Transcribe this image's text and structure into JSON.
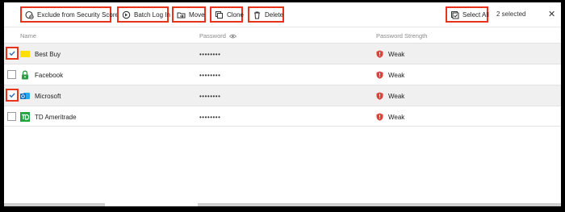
{
  "toolbar": {
    "exclude_label": "Exclude from Security Score",
    "batch_login_label": "Batch Log In",
    "move_label": "Move",
    "clone_label": "Clone",
    "delete_label": "Delete",
    "select_all_label": "Select All",
    "selected_count": "2 selected",
    "close_symbol": "✕"
  },
  "columns": {
    "name": "Name",
    "password": "Password",
    "strength": "Password Strength"
  },
  "rows": [
    {
      "name": "Best Buy",
      "password": "••••••••",
      "strength": "Weak",
      "checked": true,
      "icon": "best-buy-logo"
    },
    {
      "name": "Facebook",
      "password": "••••••••",
      "strength": "Weak",
      "checked": false,
      "icon": "lock-icon"
    },
    {
      "name": "Microsoft",
      "password": "••••••••",
      "strength": "Weak",
      "checked": true,
      "icon": "outlook-logo"
    },
    {
      "name": "TD Ameritrade",
      "password": "••••••••",
      "strength": "Weak",
      "checked": false,
      "icon": "td-logo"
    }
  ],
  "colors": {
    "highlight": "#e8341c",
    "weak": "#e0403a",
    "selected_row": "#f0f0f0"
  }
}
